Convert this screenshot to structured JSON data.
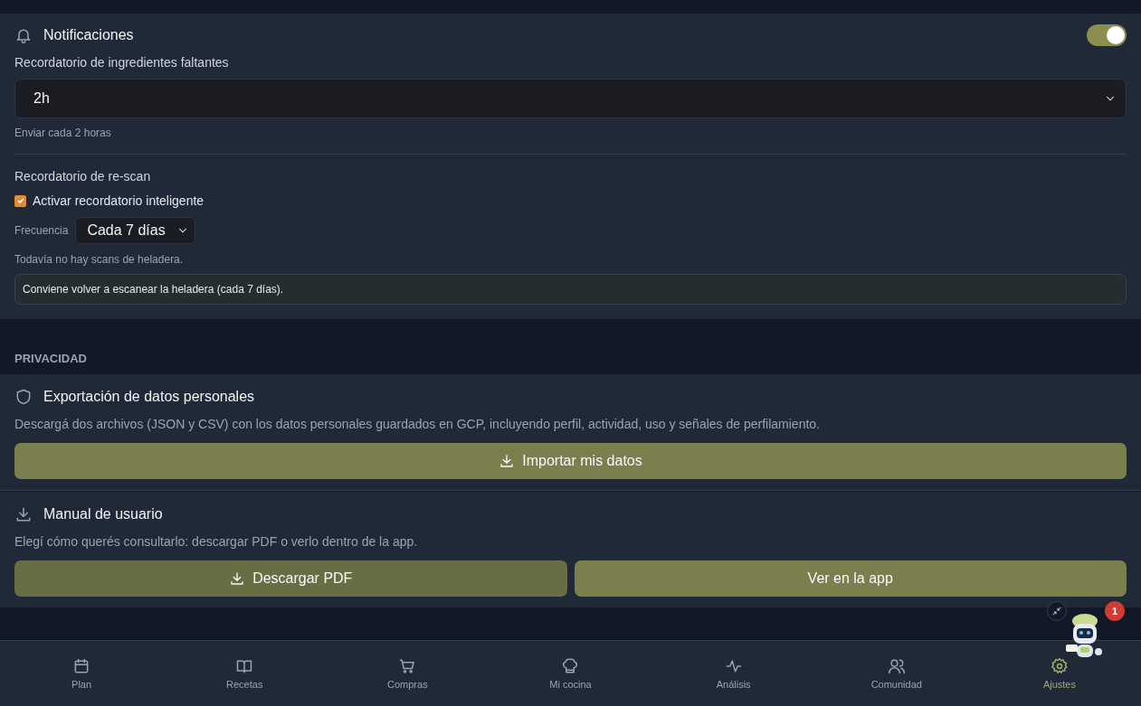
{
  "notifications": {
    "title": "Notificaciones",
    "enabled": true,
    "missing_reminder": {
      "label": "Recordatorio de ingredientes faltantes",
      "value": "2h",
      "hint": "Enviar cada 2 horas"
    },
    "rescan": {
      "label": "Recordatorio de re-scan",
      "checkbox": {
        "label": "Activar recordatorio inteligente",
        "checked": true
      },
      "frequency_label": "Frecuencia",
      "frequency_value": "Cada 7 días",
      "status": "Todavía no hay scans de heladera.",
      "notice": "Conviene volver a escanear la heladera (cada 7 días)."
    }
  },
  "privacy": {
    "heading": "PRIVACIDAD",
    "export": {
      "title": "Exportación de datos personales",
      "description": "Descargá dos archivos (JSON y CSV) con los datos personales guardados en GCP, incluyendo perfil, actividad, uso y señales de perfilamiento.",
      "button": "Importar mis datos"
    },
    "manual": {
      "title": "Manual de usuario",
      "description": "Elegí cómo querés consultarlo: descargar PDF o verlo dentro de la app.",
      "buttons": [
        {
          "label": "Descargar PDF",
          "icon": true,
          "hovered": true
        },
        {
          "label": "Ver en la app",
          "icon": false,
          "hovered": false
        }
      ]
    }
  },
  "assistant": {
    "badge": "1"
  },
  "bottom_nav": [
    {
      "label": "Plan",
      "selected": false
    },
    {
      "label": "Recetas",
      "selected": false
    },
    {
      "label": "Compras",
      "selected": false
    },
    {
      "label": "Mi cocina",
      "selected": false
    },
    {
      "label": "Análisis",
      "selected": false
    },
    {
      "label": "Comunidad",
      "selected": false
    },
    {
      "label": "Ajustes",
      "selected": true
    }
  ]
}
